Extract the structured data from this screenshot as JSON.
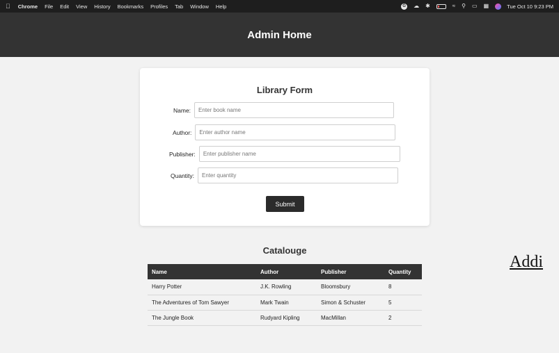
{
  "menubar": {
    "app": "Chrome",
    "items": [
      "File",
      "Edit",
      "View",
      "History",
      "Bookmarks",
      "Profiles",
      "Tab",
      "Window",
      "Help"
    ],
    "clock": "Tue Oct 10  9:23 PM"
  },
  "header": {
    "title": "Admin Home"
  },
  "form": {
    "title": "Library Form",
    "fields": [
      {
        "label": "Name:",
        "placeholder": "Enter book name",
        "value": ""
      },
      {
        "label": "Author:",
        "placeholder": "Enter author name",
        "value": ""
      },
      {
        "label": "Publisher:",
        "placeholder": "Enter publisher name",
        "value": ""
      },
      {
        "label": "Quantity:",
        "placeholder": "Enter quantity",
        "value": ""
      }
    ],
    "submit_label": "Submit"
  },
  "catalogue": {
    "title": "Catalouge",
    "columns": [
      "Name",
      "Author",
      "Publisher",
      "Quantity"
    ],
    "rows": [
      [
        "Harry Potter",
        "J.K. Rowling",
        "Bloomsbury",
        "8"
      ],
      [
        "The Adventures of Tom Sawyer",
        "Mark Twain",
        "Simon & Schuster",
        "5"
      ],
      [
        "The Jungle Book",
        "Rudyard Kipling",
        "MacMillan",
        "2"
      ]
    ]
  },
  "adding_link": {
    "label": "Addi"
  },
  "colors": {
    "header_bg": "#333333",
    "page_bg": "#f2f2f2",
    "button_bg": "#2b2b2b"
  }
}
